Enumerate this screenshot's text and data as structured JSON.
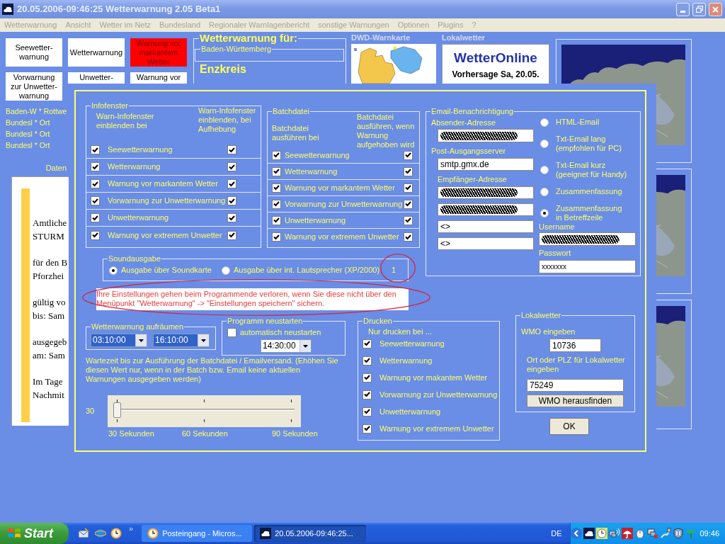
{
  "window": {
    "title": "20.05.2006-09:46:25 Wetterwarnung 2.05 Beta1"
  },
  "menu": [
    {
      "label": "Wetterwarnung",
      "disabled": true
    },
    {
      "label": "Ansicht",
      "disabled": true
    },
    {
      "label": "Wetter im Netz",
      "disabled": true
    },
    {
      "label": "Bundesland",
      "disabled": true
    },
    {
      "label": "Regionaler Warnlagenbericht",
      "disabled": true
    },
    {
      "label": "sonstige Warnungen",
      "disabled": true
    },
    {
      "label": "Optionen",
      "disabled": true
    },
    {
      "label": "Plugins",
      "disabled": true
    },
    {
      "label": "?",
      "disabled": true
    }
  ],
  "warning_buttons": [
    {
      "label": "Seewetter-warnung",
      "active": false,
      "clipped": false
    },
    {
      "label": "Wetterwarnung",
      "active": false,
      "clipped": false
    },
    {
      "label": "Warnung vor markantem Wetter",
      "active": true,
      "clipped": false
    },
    {
      "label": "Vorwarnung zur Unwetter-warnung",
      "active": false,
      "clipped": false
    },
    {
      "label": "Unwetter-",
      "active": false,
      "clipped": true
    },
    {
      "label": "Warnung vor",
      "active": false,
      "clipped": true
    }
  ],
  "regions": [
    "Baden-W * Rottwe",
    "Bundesl * Ort",
    "Bundesl * Ort",
    "Bundesl * Ort"
  ],
  "data_panel": {
    "title": "Daten",
    "paragraphs": [
      [
        "Amtliche",
        "STURM"
      ],
      [
        "für den B",
        "Pforzhei"
      ],
      [
        "gültig vo",
        "bis: Sam"
      ],
      [
        "ausgegeb",
        "am: Sam"
      ],
      [
        "Im Tage",
        "Nachmit"
      ]
    ]
  },
  "location": {
    "title": "Wetterwarnung für:",
    "state": "Baden-Württemberg",
    "district": "Enzkreis"
  },
  "warning_map": {
    "title": "DWD-Warnkarte"
  },
  "local_forecast": {
    "title": "Lokalwetter",
    "logo": "WetterOnline",
    "heading": "Vorhersage Sa, 20.05."
  },
  "dialog": {
    "info_window": {
      "title": "Infofenster",
      "header": "Warn-Infofenster einblenden bei",
      "header_on_lift": "Warn-Infofenster einblenden, bei Aufhebung",
      "rows": [
        {
          "label": "Seewetterwarnung",
          "checked": true,
          "checked_on_lift": true
        },
        {
          "label": "Wetterwarnung",
          "checked": true,
          "checked_on_lift": true
        },
        {
          "label": "Warnung vor markantem Wetter",
          "checked": true,
          "checked_on_lift": true
        },
        {
          "label": "Vorwarnung zur Unwetterwarnung",
          "checked": true,
          "checked_on_lift": true
        },
        {
          "label": "Unwetterwarnung",
          "checked": true,
          "checked_on_lift": true
        },
        {
          "label": "Warnung vor extremem Unwetter",
          "checked": true,
          "checked_on_lift": true
        }
      ]
    },
    "batch_file": {
      "title": "Batchdatei",
      "header": "Batchdatei ausführen bei",
      "header_on_lift": "Batchdatei ausführen, wenn Warnung aufgehoben wird",
      "rows": [
        {
          "label": "Seewetterwarnung",
          "checked": true,
          "checked_on_lift": true
        },
        {
          "label": "Wetterwarnung",
          "checked": true,
          "checked_on_lift": true
        },
        {
          "label": "Warnung vor markantem Wetter",
          "checked": true,
          "checked_on_lift": true
        },
        {
          "label": "Vorwarnung zur Unwetterwarnung",
          "checked": true,
          "checked_on_lift": true
        },
        {
          "label": "Unwetterwarnung",
          "checked": true,
          "checked_on_lift": true
        },
        {
          "label": "Warnung vor extremem Unwetter",
          "checked": true,
          "checked_on_lift": true
        }
      ]
    },
    "email": {
      "title": "Email-Benachrichtigung",
      "sender": {
        "label": "Absender-Adresse",
        "redacted": true
      },
      "server": {
        "label": "Post-Ausgangsserver",
        "value": "smtp.gmx.de",
        "redacted": false
      },
      "recipients": {
        "label": "Empfänger-Adresse",
        "fields": [
          {
            "redacted": true
          },
          {
            "redacted": true
          },
          {
            "value": "<>",
            "redacted": false
          },
          {
            "value": "<>",
            "redacted": false
          }
        ]
      },
      "formats": [
        {
          "label": "HTML-Email",
          "selected": false
        },
        {
          "label": "Txt-Email lang (empfohlen für PC)",
          "selected": false
        },
        {
          "label": "Txt-Email kurz (geeignet für Handy)",
          "selected": false
        },
        {
          "label": "Zusammenfassung",
          "selected": false
        },
        {
          "label": "Zusammenfassung in Betreffzeile",
          "selected": true
        }
      ],
      "username": {
        "label": "Username",
        "redacted": true
      },
      "password": {
        "label": "Passwort",
        "value": "xxxxxxx",
        "redacted": false
      }
    },
    "sound": {
      "title": "Soundausgabe",
      "options": [
        {
          "label": "Ausgabe über Soundkarte",
          "selected": true
        },
        {
          "label": "Ausgabe über int. Lautsprecher (XP/2000)",
          "selected": false
        }
      ],
      "device": "1"
    },
    "notice": "Ihre Einstellungen gehen beim Programmende verloren, wenn Sie diese nicht über den Menüpunkt \"Wetterwarnung\" -> \"Einstellungen speichern\" sichern.",
    "cleanup": {
      "title": "Wetterwarnung aufräumen",
      "times": [
        {
          "value": "03:10:00",
          "highlighted": true
        },
        {
          "value": "16:10:00",
          "highlighted": true
        }
      ]
    },
    "restart": {
      "title": "Programm neustarten",
      "label": "automatisch neustarten",
      "checked": false,
      "time": {
        "value": "14:30:00",
        "highlighted": false
      }
    },
    "wait_note": "Wartezeit bis zur Ausführung der Batchdatei / Emailversand. (Ehöhen Sie diesen Wert nur, wenn in der Batch bzw. Email keine aktuellen Warnungen ausgegeben werden)",
    "wait_slider": {
      "reading": "30",
      "level": 0,
      "ticks": [
        "30 Sekunden",
        "60 Sekunden",
        "90 Sekunden"
      ]
    },
    "print": {
      "title": "Drucken",
      "subtitle": "Nur drucken bei ...",
      "options": [
        {
          "label": "Seewetterwarnung",
          "checked": true
        },
        {
          "label": "Wetterwarnung",
          "checked": true
        },
        {
          "label": "Warnung vor makantem Wetter",
          "checked": true
        },
        {
          "label": "Vorwarnung zur Unwetterwarnung",
          "checked": true
        },
        {
          "label": "Unwetterwarnung",
          "checked": true
        },
        {
          "label": "Warnung vor extremem Unwetter",
          "checked": true
        }
      ]
    },
    "local_weather": {
      "title": "Lokalwetter",
      "wmo_label": "WMO eingeben",
      "wmo": "10736",
      "place_label": "Ort oder PLZ für Lokalwetter eingeben",
      "place": "75249",
      "find_button": "WMO herausfinden"
    },
    "ok_button": "OK"
  },
  "taskbar": {
    "start": "Start",
    "more": "»",
    "tasks": [
      {
        "label": "Posteingang - Micros...",
        "selected": false
      },
      {
        "label": "20.05.2006-09:46:25...",
        "selected": true
      }
    ],
    "language": "DE",
    "clock": "09:46"
  }
}
